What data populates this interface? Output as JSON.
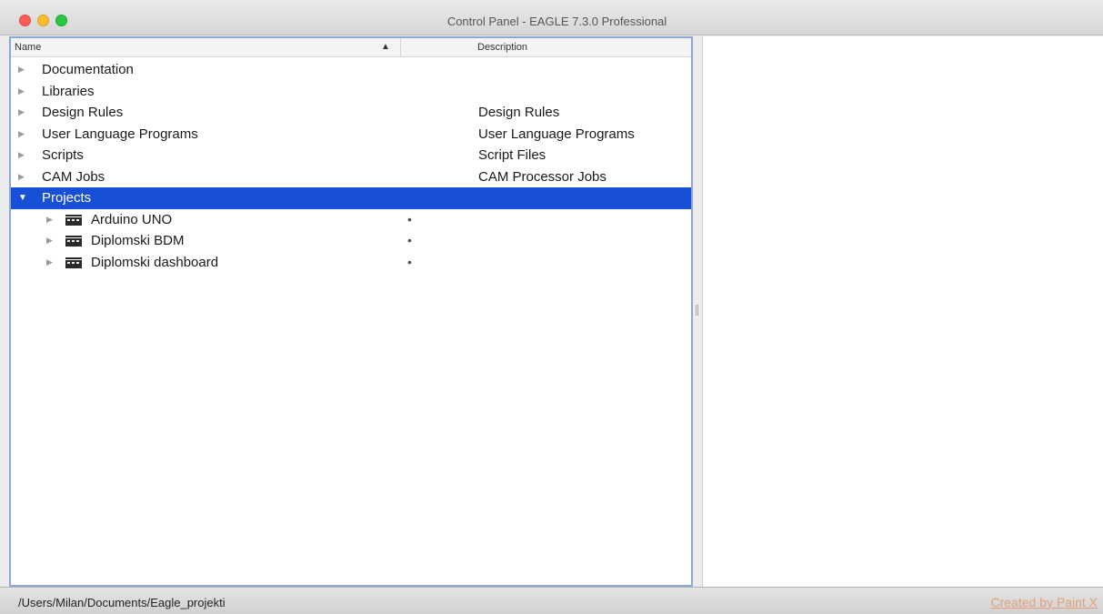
{
  "window": {
    "title": "Control Panel - EAGLE 7.3.0 Professional"
  },
  "tree": {
    "header": {
      "name": "Name",
      "sort_indicator": "▲",
      "description": "Description"
    },
    "items": [
      {
        "label": "Documentation",
        "description": ""
      },
      {
        "label": "Libraries",
        "description": ""
      },
      {
        "label": "Design Rules",
        "description": "Design Rules"
      },
      {
        "label": "User Language Programs",
        "description": "User Language Programs"
      },
      {
        "label": "Scripts",
        "description": "Script Files"
      },
      {
        "label": "CAM Jobs",
        "description": "CAM Processor Jobs"
      },
      {
        "label": "Projects",
        "description": "",
        "expanded": true,
        "selected": true
      }
    ],
    "projects": [
      {
        "label": "Arduino UNO",
        "marker": "•"
      },
      {
        "label": "Diplomski BDM",
        "marker": "•"
      },
      {
        "label": "Diplomski dashboard",
        "marker": "•"
      }
    ]
  },
  "status": {
    "path": "/Users/Milan/Documents/Eagle_projekti",
    "watermark": "Created by Paint X"
  },
  "colors": {
    "selection": "#1750d6",
    "pane_border": "#89a9d6"
  },
  "icons": {
    "collapsed": "disclosure-right-icon",
    "expanded": "disclosure-down-icon",
    "project": "folder-icon"
  }
}
